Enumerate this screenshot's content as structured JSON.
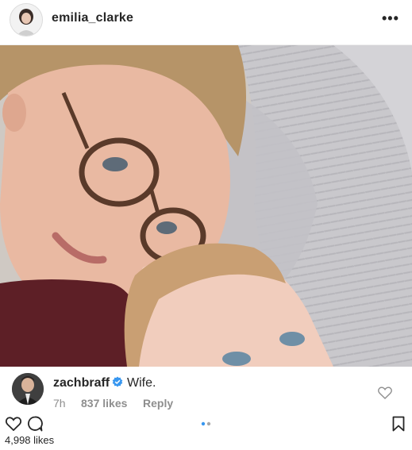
{
  "post": {
    "username": "emilia_clarke",
    "more_label": "•••",
    "likes_label": "4,998 likes"
  },
  "comment": {
    "username": "zachbraff",
    "text": "Wife.",
    "time": "7h",
    "likes": "837 likes",
    "reply_label": "Reply"
  },
  "carousel": {
    "current": 1,
    "total": 2
  },
  "icons": {
    "more": "more-options-icon",
    "verified": "verified-badge-icon",
    "comment_like": "heart-outline-icon",
    "like": "heart-outline-icon",
    "comment": "comment-bubble-icon",
    "save": "bookmark-icon"
  },
  "colors": {
    "verified": "#3897f0",
    "carousel_active": "#3897f0",
    "carousel_inactive": "#a8a8a8",
    "text": "#262626",
    "muted": "#8e8e8e"
  }
}
